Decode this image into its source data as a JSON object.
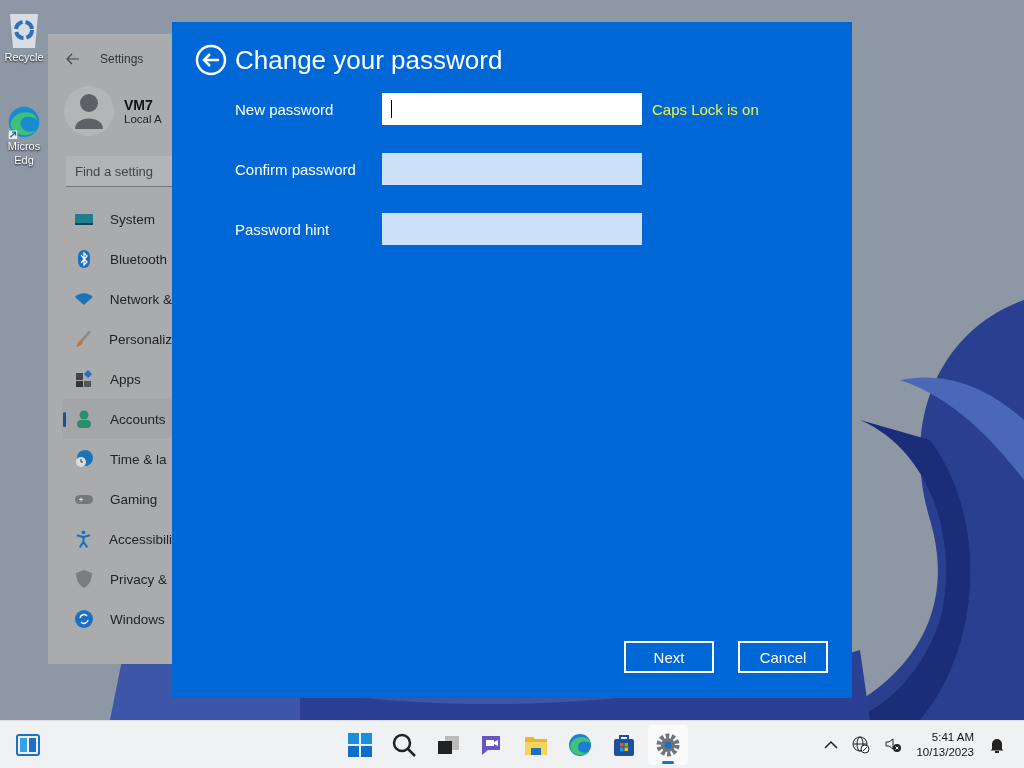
{
  "desktop_icons": [
    {
      "kind": "recycle",
      "lines": [
        "Recycle"
      ]
    },
    {
      "kind": "edge",
      "lines": [
        "Micros",
        "Edg"
      ]
    }
  ],
  "settings": {
    "title": "Settings",
    "user_name": "VM7",
    "account_type": "Local A",
    "search": {
      "placeholder": "Find a setting"
    },
    "nav": [
      {
        "kind": "system",
        "label": "System",
        "selected": false
      },
      {
        "kind": "bluetooth",
        "label": "Bluetooth",
        "selected": false
      },
      {
        "kind": "network",
        "label": "Network &",
        "selected": false
      },
      {
        "kind": "personalization",
        "label": "Personaliz",
        "selected": false
      },
      {
        "kind": "apps",
        "label": "Apps",
        "selected": false
      },
      {
        "kind": "accounts",
        "label": "Accounts",
        "selected": true
      },
      {
        "kind": "time",
        "label": "Time & la",
        "selected": false
      },
      {
        "kind": "gaming",
        "label": "Gaming",
        "selected": false
      },
      {
        "kind": "accessibility",
        "label": "Accessibili",
        "selected": false
      },
      {
        "kind": "privacy",
        "label": "Privacy &",
        "selected": false
      },
      {
        "kind": "update",
        "label": "Windows",
        "selected": false
      }
    ]
  },
  "dialog": {
    "title": "Change your password",
    "fields": [
      {
        "label": "New password",
        "focused": true
      },
      {
        "label": "Confirm password",
        "focused": false
      },
      {
        "label": "Password hint",
        "focused": false
      }
    ],
    "caps_lock_warning": "Caps Lock is on",
    "buttons": [
      "Next",
      "Cancel"
    ]
  },
  "taskbar": {
    "apps": [
      {
        "kind": "start",
        "active": false
      },
      {
        "kind": "search",
        "active": false
      },
      {
        "kind": "taskview",
        "active": false
      },
      {
        "kind": "chat",
        "active": false
      },
      {
        "kind": "explorer",
        "active": false
      },
      {
        "kind": "edge",
        "active": false
      },
      {
        "kind": "store",
        "active": false
      },
      {
        "kind": "settings",
        "active": true
      }
    ],
    "time": "5:41 AM",
    "date": "10/13/2023"
  }
}
